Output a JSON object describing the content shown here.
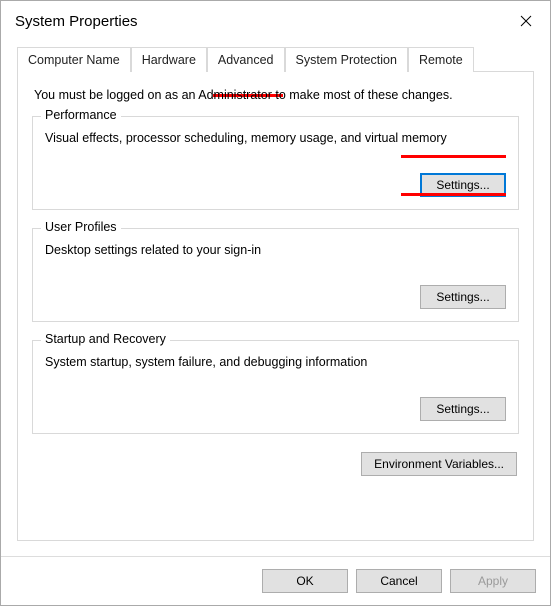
{
  "title": "System Properties",
  "tabs": {
    "computer_name": "Computer Name",
    "hardware": "Hardware",
    "advanced": "Advanced",
    "system_protection": "System Protection",
    "remote": "Remote"
  },
  "admin_note": "You must be logged on as an Administrator to make most of these changes.",
  "performance": {
    "legend": "Performance",
    "desc": "Visual effects, processor scheduling, memory usage, and virtual memory",
    "button": "Settings..."
  },
  "user_profiles": {
    "legend": "User Profiles",
    "desc": "Desktop settings related to your sign-in",
    "button": "Settings..."
  },
  "startup": {
    "legend": "Startup and Recovery",
    "desc": "System startup, system failure, and debugging information",
    "button": "Settings..."
  },
  "env_button": "Environment Variables...",
  "buttons": {
    "ok": "OK",
    "cancel": "Cancel",
    "apply": "Apply"
  }
}
